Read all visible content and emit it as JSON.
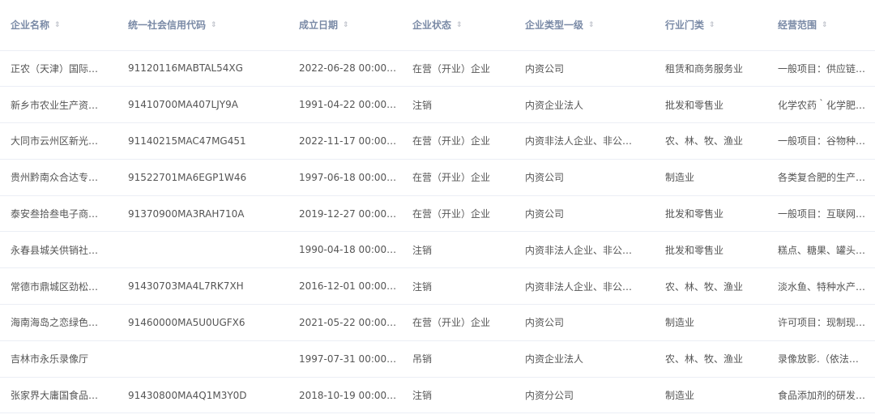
{
  "table": {
    "columns": [
      {
        "label": "企业名称",
        "sort_icon": "sort-icon"
      },
      {
        "label": "统一社会信用代码",
        "sort_icon": "sort-icon"
      },
      {
        "label": "成立日期",
        "sort_icon": "sort-icon"
      },
      {
        "label": "企业状态",
        "sort_icon": "sort-icon"
      },
      {
        "label": "企业类型一级",
        "sort_icon": "sort-icon"
      },
      {
        "label": "行业门类",
        "sort_icon": "sort-icon"
      },
      {
        "label": "经营范围",
        "sort_icon": "sort-icon"
      }
    ],
    "rows": [
      [
        "正农（天津）国际…",
        "91120116MABTAL54XG",
        "2022-06-28 00:00…",
        "在营（开业）企业",
        "内资公司",
        "租赁和商务服务业",
        "一般项目：供应链…"
      ],
      [
        "新乡市农业生产资…",
        "91410700MA407LJY9A",
        "1991-04-22 00:00…",
        "注销",
        "内资企业法人",
        "批发和零售业",
        "化学农药｀化学肥…"
      ],
      [
        "大同市云州区新光…",
        "91140215MAC47MG451",
        "2022-11-17 00:00…",
        "在营（开业）企业",
        "内资非法人企业、非公…",
        "农、林、牧、渔业",
        "一般项目：谷物种…"
      ],
      [
        "贵州黔南众合达专…",
        "91522701MA6EGP1W46",
        "1997-06-18 00:00…",
        "在营（开业）企业",
        "内资公司",
        "制造业",
        "各类复合肥的生产…"
      ],
      [
        "泰安叁拾叁电子商…",
        "91370900MA3RAH710A",
        "2019-12-27 00:00…",
        "在营（开业）企业",
        "内资公司",
        "批发和零售业",
        "一般项目：互联网…"
      ],
      [
        "永春县城关供销社…",
        "",
        "1990-04-18 00:00…",
        "注销",
        "内资非法人企业、非公…",
        "批发和零售业",
        "糕点、糖果、罐头…"
      ],
      [
        "常德市鼎城区劲松…",
        "91430703MA4L7RK7XH",
        "2016-12-01 00:00…",
        "注销",
        "内资非法人企业、非公…",
        "农、林、牧、渔业",
        "淡水鱼、特种水产…"
      ],
      [
        "海南海岛之恋绿色…",
        "91460000MA5U0UGFX6",
        "2021-05-22 00:00…",
        "在营（开业）企业",
        "内资公司",
        "制造业",
        "许可项目：现制现…"
      ],
      [
        "吉林市永乐录像厅",
        "",
        "1997-07-31 00:00…",
        "吊销",
        "内资企业法人",
        "农、林、牧、渔业",
        "录像放影.（依法…"
      ],
      [
        "张家界大庸国食品…",
        "91430800MA4Q1M3Y0D",
        "2018-10-19 00:00…",
        "注销",
        "内资分公司",
        "制造业",
        "食品添加剂的研发…"
      ]
    ]
  },
  "colors": {
    "header_text": "#7a8aa6",
    "cell_text": "#555555",
    "row_border": "#ebeef5",
    "sort_icon": "#c0c4cc"
  }
}
